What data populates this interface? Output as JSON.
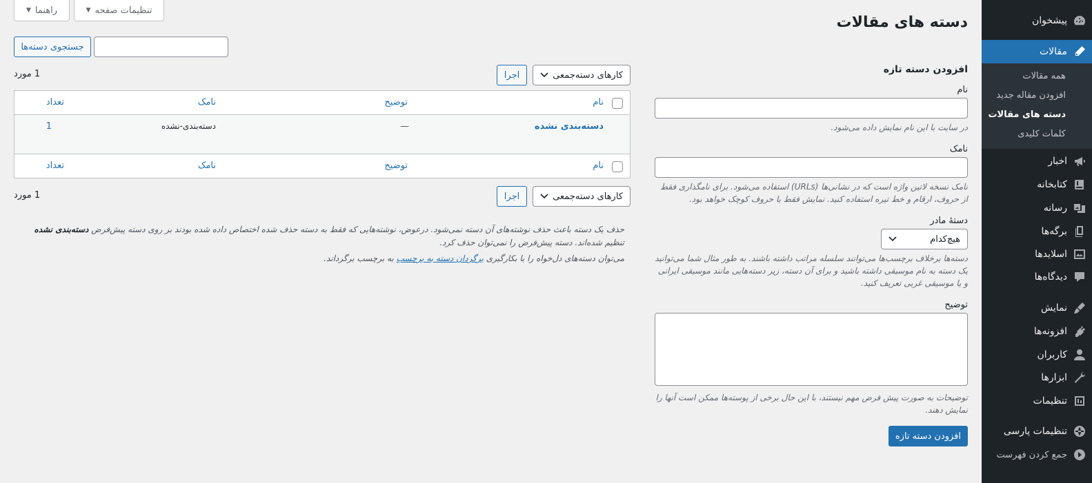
{
  "menu": {
    "items": [
      {
        "label": "پیشخوان",
        "icon": "dashboard-icon"
      },
      {
        "label": "مقالات",
        "icon": "pin-icon",
        "current": true
      },
      {
        "label": "اخبار",
        "icon": "megaphone-icon"
      },
      {
        "label": "کتابخانه",
        "icon": "book-icon"
      },
      {
        "label": "رسانه",
        "icon": "media-icon"
      },
      {
        "label": "برگه‌ها",
        "icon": "pages-icon"
      },
      {
        "label": "اسلایدها",
        "icon": "slides-icon"
      },
      {
        "label": "دیدگاه‌ها",
        "icon": "comments-icon"
      },
      {
        "label": "نمایش",
        "icon": "appearance-icon"
      },
      {
        "label": "افزونه‌ها",
        "icon": "plugins-icon"
      },
      {
        "label": "کاربران",
        "icon": "users-icon"
      },
      {
        "label": "ابزارها",
        "icon": "tools-icon"
      },
      {
        "label": "تنظیمات",
        "icon": "settings-icon"
      },
      {
        "label": "تنظیمات پارسی",
        "icon": "globe-icon"
      },
      {
        "label": "جمع کردن فهرست",
        "icon": "collapse-icon"
      }
    ],
    "submenu": [
      {
        "label": "همه مقالات"
      },
      {
        "label": "افزودن مقاله جدید"
      },
      {
        "label": "دسته های مقالات",
        "current": true
      },
      {
        "label": "کلمات کلیدی"
      }
    ]
  },
  "screen_meta": {
    "screen_options": "تنظیمات صفحه",
    "help": "راهنما"
  },
  "page_title": "دسته های مقالات",
  "form": {
    "heading": "افزودن دسته تازه",
    "name_label": "نام",
    "name_desc": "در سایت با این نام نمایش داده می‌شود.",
    "slug_label": "نامک",
    "slug_desc": "نامک نسخه لاتین واژه است که در نشانی‌ها (URLs) استفاده می‌شود. برای نامگذاری فقط از حروف، ارقام و خط تیره استفاده کنید. نمایش فقط با حروف کوچک خواهد بود.",
    "parent_label": "دستهٔ مادر",
    "parent_value": "هیچ‌کدام",
    "parent_desc": "دسته‌ها برخلاف برچسب‌ها می‌توانند سلسله مراتب داشته باشند. به طور مثال شما می‌توانید یک دسته به نام موسیقی داشته باشید و برای آن دسته، زیر دسته‌هایی مانند موسیقی ایرانی و یا موسیقی غربی تعریف کنید.",
    "description_label": "توضیح",
    "description_desc": "توضیحات به صورت پیش فرض مهم نیستند، با این حال برخی از پوسته‌ها ممکن است آنها را نمایش دهند.",
    "submit": "افزودن دسته تازه"
  },
  "search": {
    "button": "جستجوی دسته‌ها",
    "value": ""
  },
  "bulk": {
    "label": "کارهای دسته‌جمعی",
    "apply": "اجرا"
  },
  "count": "1 مورد",
  "table": {
    "columns": {
      "name": "نام",
      "description": "توضیح",
      "slug": "نامک",
      "count": "تعداد"
    },
    "rows": [
      {
        "name": "دسته‌بندی نشده",
        "description": "—",
        "slug": "دسته‌بندی-نشده",
        "count": "1"
      }
    ]
  },
  "notes": {
    "line1_a": "حذف یک دسته باعث حذف نوشته‌های آن دسته نمی‌شود. درعوض، نوشته‌هایی که فقط به دسته حذف شده اختصاص داده شده بودند بر روی دسته پیش‌فرض ",
    "line1_bold": "دسته‌بندی نشده",
    "line1_b": " تنظیم شده‌اند. دسته پیش‌فرض را نمی‌توان حذف کرد.",
    "line2_a": "می‌توان دسته‌های دل‌خواه را با بکارگیری ",
    "line2_link": "برگردان دسته به برچسب",
    "line2_b": " به برچسب برگرداند."
  },
  "colors": {
    "sidebar": "#1d2327",
    "accent": "#2271b1",
    "background": "#f0f0f1"
  }
}
